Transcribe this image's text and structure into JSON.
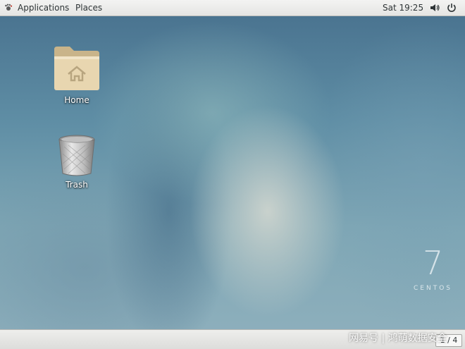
{
  "topbar": {
    "applications_label": "Applications",
    "places_label": "Places",
    "clock": "Sat 19:25",
    "icons": [
      "gnome-foot-icon",
      "volume-icon",
      "power-icon"
    ]
  },
  "desktop": {
    "icons": [
      {
        "label": "Home",
        "icon": "home-folder-icon"
      },
      {
        "label": "Trash",
        "icon": "trash-icon"
      }
    ]
  },
  "branding": {
    "version_number": "7",
    "os_name": "CENTOS"
  },
  "bottombar": {
    "workspace": "1 / 4"
  },
  "watermark": {
    "text": "网易号 | 鸿萌数据安全"
  },
  "colors": {
    "folder": "#e8d6b0",
    "topbar_bg": "#ececea",
    "wallpaper_dark": "#47708d",
    "wallpaper_light": "#cfd5cf"
  }
}
